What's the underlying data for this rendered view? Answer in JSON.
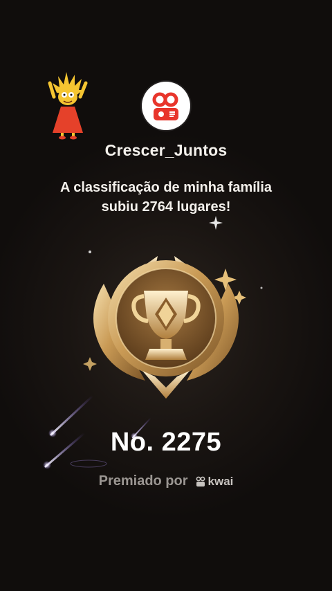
{
  "profile": {
    "username": "Crescer_Juntos",
    "avatar_icon": "kwai-logo-icon"
  },
  "sticker": {
    "icon": "cartoon-character-sticker-icon"
  },
  "announcement": {
    "line1": "A classificação de minha família",
    "line2": "subiu 2764 lugares!"
  },
  "badge": {
    "icon": "gold-trophy-medal-icon"
  },
  "rank": {
    "label": "No. 2275"
  },
  "footer": {
    "awarded_by": "Premiado por",
    "brand": "kwai",
    "brand_icon": "kwai-small-logo-icon"
  },
  "colors": {
    "background": "#100d0c",
    "text": "#f4f1ec",
    "muted": "#9b9692",
    "gold": "#d9b26a",
    "brand_red": "#e8352b"
  }
}
